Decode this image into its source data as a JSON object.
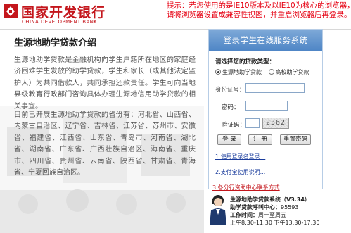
{
  "header": {
    "logo_cn": "国家开发银行",
    "logo_en": "CHINA DEVELOPMENT BANK",
    "browser_notice": [
      "提示：若您使用的是IE10版本及以IE10为核心的浏览器，",
      "请将浏览器设置成兼容性视图，并重启浏览器后再登录。"
    ]
  },
  "intro": {
    "title": "生源地助学贷款介绍",
    "paragraph1": "生源地助学贷款是金融机构向学生户籍所在地区的家庭经济困难学生发放的助学贷款，学生和家长（或其他法定监护人）为共同借款人，共同承担还款责任。学生可向当地县级教育行政部门咨询具体办理生源地信用助学贷款的相关事宜。",
    "paragraph2": "目前已开展生源地助学贷款的省份有：河北省、山西省、内蒙古自治区、辽宁省、吉林省、江苏省、苏州市、安徽省、福建省、江西省、山东省、青岛市、河南省、湖北省、湖南省、广东省、广西壮族自治区、海南省、重庆市、四川省、贵州省、云南省、陕西省、甘肃省、青海省、宁夏回族自治区。"
  },
  "login": {
    "panel_title": "登录学生在线服务系统",
    "loan_type_label": "请选择您的贷款类型：",
    "loan_types": [
      {
        "label": "生源地助学贷款",
        "checked": true
      },
      {
        "label": "高校助学贷款",
        "checked": false
      }
    ],
    "id_label": "身份证号：",
    "id_value": "",
    "password_label": "密码：",
    "password_value": "",
    "captcha_label": "验证码：",
    "captcha_value": "",
    "captcha_text": "2362",
    "login_button": "登 录",
    "register_button": "注 册",
    "reset_button": "重置密码",
    "links": [
      "1.使用登录名登录...",
      "2.支付宝使用说明...",
      "3.各分行资助中心联系方式"
    ]
  },
  "hotline": {
    "system_name": "生源地助学贷款系统",
    "version": "（V3.34）",
    "line_label": "助学贷款呼叫中心：",
    "phone": "95593",
    "hours_label": "工作时间：",
    "days": "周一至周五",
    "times": "上午8:30-11:30  下午13:30-17:30"
  },
  "colors": {
    "brand_red": "#c4161c",
    "notice_red": "#e60012",
    "panel_blue": "#4f86c6",
    "link_blue": "#1a3c9c"
  }
}
